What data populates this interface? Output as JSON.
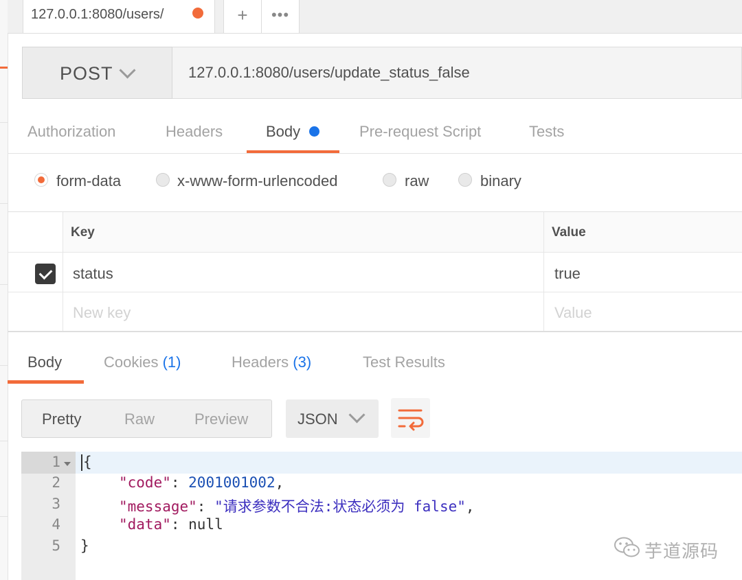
{
  "tab": {
    "title": "127.0.0.1:8080/users/"
  },
  "tab_actions": {
    "plus": "+",
    "more": "•••"
  },
  "request": {
    "method": "POST",
    "url": "127.0.0.1:8080/users/update_status_false"
  },
  "request_tabs": [
    "Authorization",
    "Headers",
    "Body",
    "Pre-request Script",
    "Tests"
  ],
  "body_types": [
    "form-data",
    "x-www-form-urlencoded",
    "raw",
    "binary"
  ],
  "params": {
    "headers": {
      "key": "Key",
      "value": "Value"
    },
    "rows": [
      {
        "key": "status",
        "value": "true",
        "checked": true
      }
    ],
    "placeholder": {
      "key": "New key",
      "value": "Value"
    }
  },
  "response_tabs": {
    "body": "Body",
    "cookies": "Cookies",
    "cookies_count": "(1)",
    "headers": "Headers",
    "headers_count": "(3)",
    "test_results": "Test Results"
  },
  "view_modes": [
    "Pretty",
    "Raw",
    "Preview"
  ],
  "format": "JSON",
  "code": {
    "line_numbers": [
      "1",
      "2",
      "3",
      "4",
      "5"
    ],
    "open_brace": "{",
    "close_brace": "}",
    "code_key": "\"code\"",
    "code_value": "2001001002",
    "message_key": "\"message\"",
    "message_value": "\"请求参数不合法:状态必须为 false\"",
    "data_key": "\"data\"",
    "data_value": "null"
  },
  "watermark": "芋道源码",
  "colors": {
    "accent": "#f26b3a",
    "link": "#1a73e8"
  }
}
